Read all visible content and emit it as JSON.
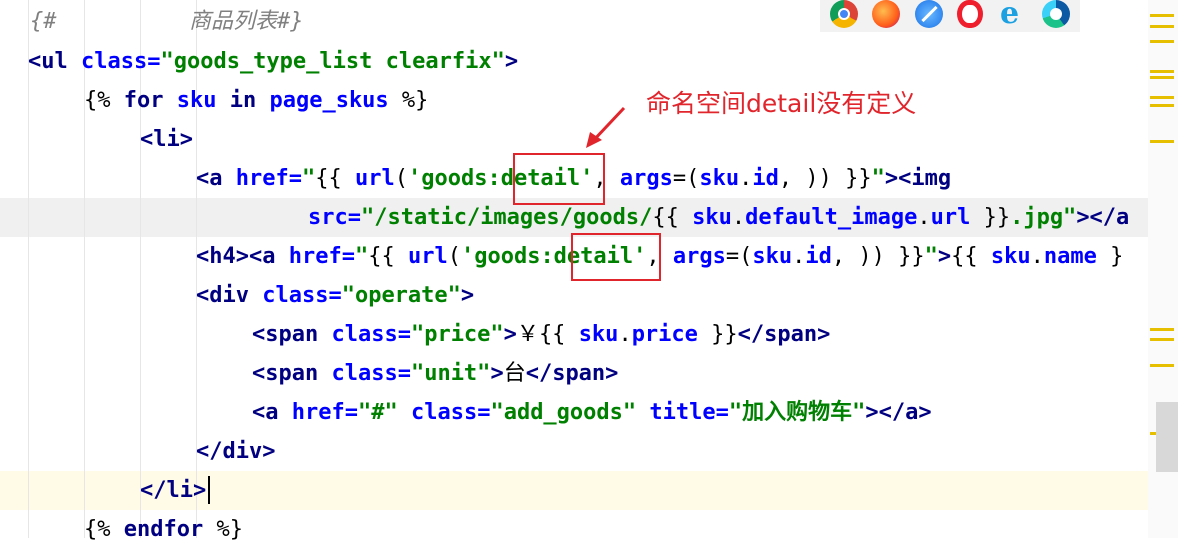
{
  "editor": {
    "lines": [
      {
        "id": "comment",
        "tokens": [
          {
            "t": "{#",
            "c": "tok-cmt"
          },
          {
            "t": "          商品列表#}",
            "c": "tok-cmt"
          }
        ]
      },
      {
        "id": "ul-open",
        "tokens": [
          {
            "t": "<ul",
            "c": "tok-tag"
          },
          {
            "t": " class=",
            "c": "tok-attr"
          },
          {
            "t": "\"goods_type_list clearfix\"",
            "c": "tok-str"
          },
          {
            "t": ">",
            "c": "tok-tag"
          }
        ]
      },
      {
        "id": "for",
        "tokens": [
          {
            "t": "{%",
            "c": "tok-var"
          },
          {
            "t": " for ",
            "c": "tok-kw"
          },
          {
            "t": "sku ",
            "c": "tok-attr"
          },
          {
            "t": "in ",
            "c": "tok-kw"
          },
          {
            "t": "page_skus ",
            "c": "tok-attr"
          },
          {
            "t": "%}",
            "c": "tok-var"
          }
        ]
      },
      {
        "id": "li-open",
        "tokens": [
          {
            "t": "<",
            "c": "tok-tag"
          },
          {
            "t": "li",
            "c": "tok-tag"
          },
          {
            "t": ">",
            "c": "tok-tag"
          }
        ]
      },
      {
        "id": "a-img",
        "tokens": [
          {
            "t": "<a",
            "c": "tok-tag"
          },
          {
            "t": " href=",
            "c": "tok-attr"
          },
          {
            "t": "\"",
            "c": "tok-str"
          },
          {
            "t": "{{ ",
            "c": "tok-var"
          },
          {
            "t": "url",
            "c": "tok-attr"
          },
          {
            "t": "(",
            "c": "tok-var"
          },
          {
            "t": "'goods:detail'",
            "c": "tok-str"
          },
          {
            "t": ", ",
            "c": "tok-var"
          },
          {
            "t": "args",
            "c": "tok-attr"
          },
          {
            "t": "=(",
            "c": "tok-var"
          },
          {
            "t": "sku",
            "c": "tok-attr"
          },
          {
            "t": ".",
            "c": "tok-var"
          },
          {
            "t": "id",
            "c": "tok-attr"
          },
          {
            "t": ", )) }}",
            "c": "tok-var"
          },
          {
            "t": "\"",
            "c": "tok-str"
          },
          {
            "t": "><img",
            "c": "tok-tag"
          }
        ]
      },
      {
        "id": "src",
        "tokens": [
          {
            "t": "src=",
            "c": "tok-attr"
          },
          {
            "t": "\"/static/images/goods/",
            "c": "tok-str"
          },
          {
            "t": "{{ ",
            "c": "tok-var"
          },
          {
            "t": "sku",
            "c": "tok-attr"
          },
          {
            "t": ".",
            "c": "tok-var"
          },
          {
            "t": "default_image",
            "c": "tok-attr"
          },
          {
            "t": ".",
            "c": "tok-var"
          },
          {
            "t": "url",
            "c": "tok-attr"
          },
          {
            "t": " }}",
            "c": "tok-var"
          },
          {
            "t": ".jpg\"",
            "c": "tok-str"
          },
          {
            "t": "></a",
            "c": "tok-tag"
          }
        ]
      },
      {
        "id": "h4",
        "tokens": [
          {
            "t": "<h4><a",
            "c": "tok-tag"
          },
          {
            "t": " href=",
            "c": "tok-attr"
          },
          {
            "t": "\"",
            "c": "tok-str"
          },
          {
            "t": "{{ ",
            "c": "tok-var"
          },
          {
            "t": "url",
            "c": "tok-attr"
          },
          {
            "t": "(",
            "c": "tok-var"
          },
          {
            "t": "'goods:detail'",
            "c": "tok-str"
          },
          {
            "t": ", ",
            "c": "tok-var"
          },
          {
            "t": "args",
            "c": "tok-attr"
          },
          {
            "t": "=(",
            "c": "tok-var"
          },
          {
            "t": "sku",
            "c": "tok-attr"
          },
          {
            "t": ".",
            "c": "tok-var"
          },
          {
            "t": "id",
            "c": "tok-attr"
          },
          {
            "t": ", )) }}",
            "c": "tok-var"
          },
          {
            "t": "\"",
            "c": "tok-str"
          },
          {
            "t": ">",
            "c": "tok-tag"
          },
          {
            "t": "{{ ",
            "c": "tok-var"
          },
          {
            "t": "sku",
            "c": "tok-attr"
          },
          {
            "t": ".",
            "c": "tok-var"
          },
          {
            "t": "name",
            "c": "tok-attr"
          },
          {
            "t": " }",
            "c": "tok-var"
          }
        ]
      },
      {
        "id": "div-open",
        "tokens": [
          {
            "t": "<div",
            "c": "tok-tag"
          },
          {
            "t": " class=",
            "c": "tok-attr"
          },
          {
            "t": "\"operate\"",
            "c": "tok-str"
          },
          {
            "t": ">",
            "c": "tok-tag"
          }
        ]
      },
      {
        "id": "price",
        "tokens": [
          {
            "t": "<span",
            "c": "tok-tag"
          },
          {
            "t": " class=",
            "c": "tok-attr"
          },
          {
            "t": "\"price\"",
            "c": "tok-str"
          },
          {
            "t": ">",
            "c": "tok-tag"
          },
          {
            "t": "￥",
            "c": "tok-plain"
          },
          {
            "t": "{{ ",
            "c": "tok-var"
          },
          {
            "t": "sku",
            "c": "tok-attr"
          },
          {
            "t": ".",
            "c": "tok-var"
          },
          {
            "t": "price",
            "c": "tok-attr"
          },
          {
            "t": " }}",
            "c": "tok-var"
          },
          {
            "t": "</span>",
            "c": "tok-tag"
          }
        ]
      },
      {
        "id": "unit",
        "tokens": [
          {
            "t": "<span",
            "c": "tok-tag"
          },
          {
            "t": " class=",
            "c": "tok-attr"
          },
          {
            "t": "\"unit\"",
            "c": "tok-str"
          },
          {
            "t": ">",
            "c": "tok-tag"
          },
          {
            "t": "台",
            "c": "tok-plain"
          },
          {
            "t": "</span>",
            "c": "tok-tag"
          }
        ]
      },
      {
        "id": "add",
        "tokens": [
          {
            "t": "<a",
            "c": "tok-tag"
          },
          {
            "t": " href=",
            "c": "tok-attr"
          },
          {
            "t": "\"#\"",
            "c": "tok-str"
          },
          {
            "t": " class=",
            "c": "tok-attr"
          },
          {
            "t": "\"add_goods\"",
            "c": "tok-str"
          },
          {
            "t": " title=",
            "c": "tok-attr"
          },
          {
            "t": "\"加入购物车\"",
            "c": "tok-str"
          },
          {
            "t": "></a>",
            "c": "tok-tag"
          }
        ]
      },
      {
        "id": "div-close",
        "tokens": [
          {
            "t": "</div>",
            "c": "tok-tag"
          }
        ]
      },
      {
        "id": "li-close",
        "tokens": [
          {
            "t": "</li>",
            "c": "tok-tag"
          }
        ]
      },
      {
        "id": "endfor",
        "tokens": [
          {
            "t": "{%",
            "c": "tok-var"
          },
          {
            "t": " endfor ",
            "c": "tok-kw"
          },
          {
            "t": "%}",
            "c": "tok-var"
          }
        ]
      }
    ]
  },
  "annotation": {
    "text": "命名空间detail没有定义",
    "color": "#e1252c"
  },
  "browser_icons": [
    "chrome-icon",
    "firefox-icon",
    "safari-icon",
    "opera-icon",
    "ie-icon",
    "edge-icon"
  ]
}
